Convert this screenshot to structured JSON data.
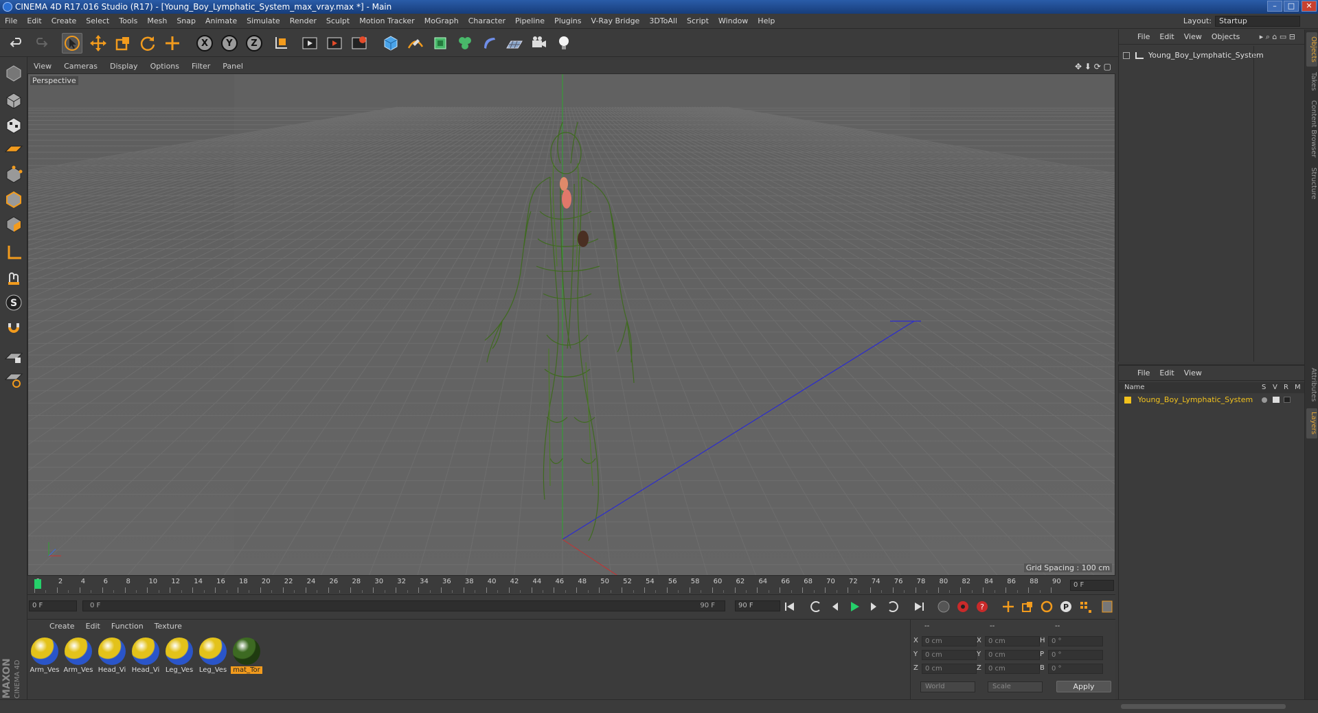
{
  "window": {
    "title": "CINEMA 4D R17.016 Studio (R17) - [Young_Boy_Lymphatic_System_max_vray.max *] - Main",
    "minimize": "–",
    "maximize": "□",
    "close": "✕"
  },
  "menubar": {
    "items": [
      "File",
      "Edit",
      "Create",
      "Select",
      "Tools",
      "Mesh",
      "Snap",
      "Animate",
      "Simulate",
      "Render",
      "Sculpt",
      "Motion Tracker",
      "MoGraph",
      "Character",
      "Pipeline",
      "Plugins",
      "V-Ray Bridge",
      "3DToAll",
      "Script",
      "Window",
      "Help"
    ],
    "layout_label": "Layout:",
    "layout_value": "Startup"
  },
  "toolbar": {
    "axis_x": "X",
    "axis_y": "Y",
    "axis_z": "Z"
  },
  "viewport": {
    "menu": [
      "View",
      "Cameras",
      "Display",
      "Options",
      "Filter",
      "Panel"
    ],
    "camera_label": "Perspective",
    "grid_spacing": "Grid Spacing : 100 cm"
  },
  "timeline": {
    "ticks": [
      "0",
      "2",
      "4",
      "6",
      "8",
      "10",
      "12",
      "14",
      "16",
      "18",
      "20",
      "22",
      "24",
      "26",
      "28",
      "30",
      "32",
      "34",
      "36",
      "38",
      "40",
      "42",
      "44",
      "46",
      "48",
      "50",
      "52",
      "54",
      "56",
      "58",
      "60",
      "62",
      "64",
      "66",
      "68",
      "70",
      "72",
      "74",
      "76",
      "78",
      "80",
      "82",
      "84",
      "86",
      "88",
      "90"
    ],
    "current_frame": "0 F"
  },
  "anim": {
    "start_frame": "0 F",
    "range_start": "0 F",
    "range_end": "90 F",
    "end_frame": "90 F"
  },
  "materials": {
    "menu": [
      "Create",
      "Edit",
      "Function",
      "Texture"
    ],
    "items": [
      {
        "name": "Arm_Ves",
        "color1": "#e3c21a",
        "color2": "#2a55c9"
      },
      {
        "name": "Arm_Ves",
        "color1": "#e3c21a",
        "color2": "#2a55c9"
      },
      {
        "name": "Head_Vi",
        "color1": "#e3c21a",
        "color2": "#2a55c9"
      },
      {
        "name": "Head_Vi",
        "color1": "#e3c21a",
        "color2": "#2a55c9"
      },
      {
        "name": "Leg_Ves",
        "color1": "#e3c21a",
        "color2": "#2a55c9"
      },
      {
        "name": "Leg_Ves",
        "color1": "#e3c21a",
        "color2": "#2a55c9"
      },
      {
        "name": "mat_Tor",
        "color1": "#3d6a22",
        "color2": "#1f3b10"
      }
    ]
  },
  "coords": {
    "header": [
      "--",
      "--",
      "--"
    ],
    "rows": [
      {
        "l1": "X",
        "v1": "0 cm",
        "l2": "X",
        "v2": "0 cm",
        "l3": "H",
        "v3": "0 °"
      },
      {
        "l1": "Y",
        "v1": "0 cm",
        "l2": "Y",
        "v2": "0 cm",
        "l3": "P",
        "v3": "0 °"
      },
      {
        "l1": "Z",
        "v1": "0 cm",
        "l2": "Z",
        "v2": "0 cm",
        "l3": "B",
        "v3": "0 °"
      }
    ],
    "world": "World",
    "scale": "Scale",
    "apply": "Apply"
  },
  "objects": {
    "menu": [
      "File",
      "Edit",
      "View",
      "Objects"
    ],
    "root": "Young_Boy_Lymphatic_System"
  },
  "layers": {
    "menu": [
      "File",
      "Edit",
      "View"
    ],
    "col_name": "Name",
    "col_s": "S",
    "col_v": "V",
    "col_r": "R",
    "col_m": "M",
    "row_name": "Young_Boy_Lymphatic_System"
  },
  "right_tabs": [
    "Objects",
    "Takes",
    "Content Browser",
    "Structure",
    "Attributes",
    "Layers"
  ],
  "brand": {
    "line1": "MAXON",
    "line2": "CINEMA 4D"
  },
  "colors": {
    "accent": "#f29b1d",
    "lymph": "#3f6a1f",
    "blue_axis": "#2b2bd0",
    "layer_yellow": "#f2c21d"
  }
}
